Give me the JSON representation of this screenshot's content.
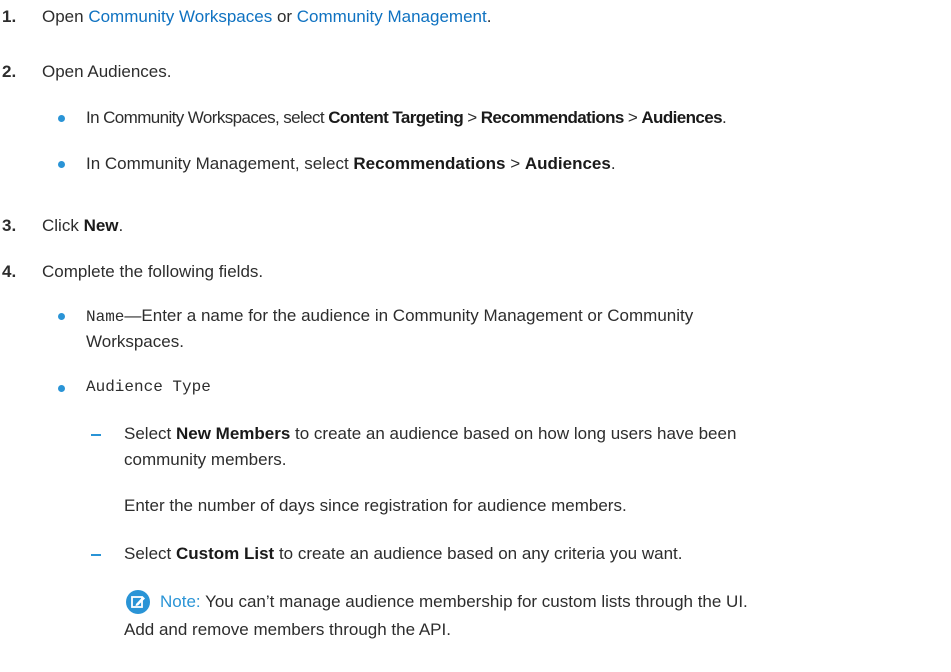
{
  "steps": [
    {
      "number": "1.",
      "prefix": "Open ",
      "link1": "Community Workspaces",
      "middle": " or ",
      "link2": "Community Management",
      "suffix": "."
    },
    {
      "number": "2.",
      "text": "Open Audiences.",
      "bullets": [
        {
          "prefix": "In Community Workspaces, select ",
          "b1": "Content Targeting",
          "sep1": " > ",
          "b2": "Recommendations",
          "sep2": " > ",
          "b3": "Audiences",
          "suffix": "."
        },
        {
          "prefix": "In Community Management, select ",
          "b1": "Recommendations",
          "sep1": " > ",
          "b2": "Audiences",
          "suffix": "."
        }
      ]
    },
    {
      "number": "3.",
      "prefix": "Click ",
      "bold": "New",
      "suffix": "."
    },
    {
      "number": "4.",
      "text": "Complete the following fields.",
      "fields": [
        {
          "name": "Name",
          "desc_line1": "—Enter a name for the audience in Community Management or Community",
          "desc_line2": "Workspaces."
        },
        {
          "name": "Audience Type",
          "options": [
            {
              "prefix": "Select ",
              "bold": "New Members",
              "line1_rest": " to create an audience based on how long users have been",
              "line2": "community members.",
              "extra": "Enter the number of days since registration for audience members."
            },
            {
              "prefix": "Select ",
              "bold": "Custom List",
              "line1_rest": " to create an audience based on any criteria you want."
            }
          ],
          "note": {
            "label": "Note:",
            "line1": "You can’t manage audience membership for custom lists through the UI.",
            "line2": "Add and remove members through the API."
          }
        }
      ]
    }
  ],
  "colors": {
    "link": "#0f72c1",
    "bullet": "#2a94d6",
    "text": "#2d2d2d"
  },
  "icons": {
    "note": "pencil-edit-icon"
  }
}
